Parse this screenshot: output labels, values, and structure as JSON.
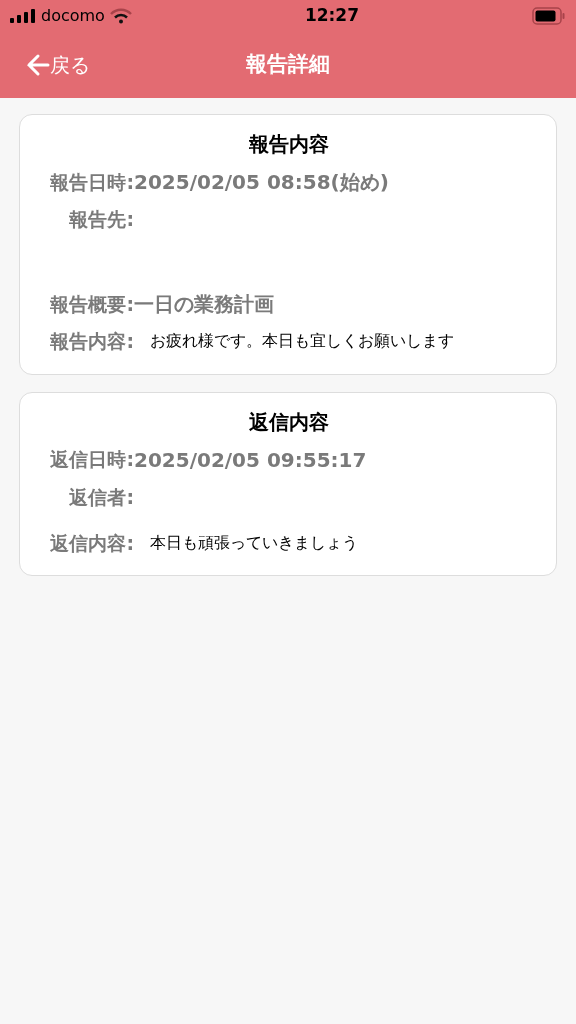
{
  "status_bar": {
    "carrier": "docomo",
    "time": "12:27"
  },
  "header": {
    "back": "戻る",
    "title": "報告詳細"
  },
  "cards": [
    {
      "title": "報告内容",
      "rows": [
        {
          "label": "報告日時:",
          "kind": "inline",
          "value": "2025/02/05 08:58(始め)"
        },
        {
          "label": "報告先:",
          "kind": "blank"
        },
        {
          "label": "報告概要:",
          "kind": "inline",
          "value": "一日の業務計画"
        },
        {
          "label": "報告内容:",
          "kind": "message",
          "value": "お疲れ様です。本日も宜しくお願いします"
        }
      ]
    },
    {
      "title": "返信内容",
      "rows": [
        {
          "label": "返信日時:",
          "kind": "inline",
          "value": "2025/02/05 09:55:17"
        },
        {
          "label": "返信者:",
          "kind": "empty"
        },
        {
          "label": "返信内容:",
          "kind": "message",
          "value": "本日も頑張っていきましょう"
        }
      ]
    }
  ]
}
